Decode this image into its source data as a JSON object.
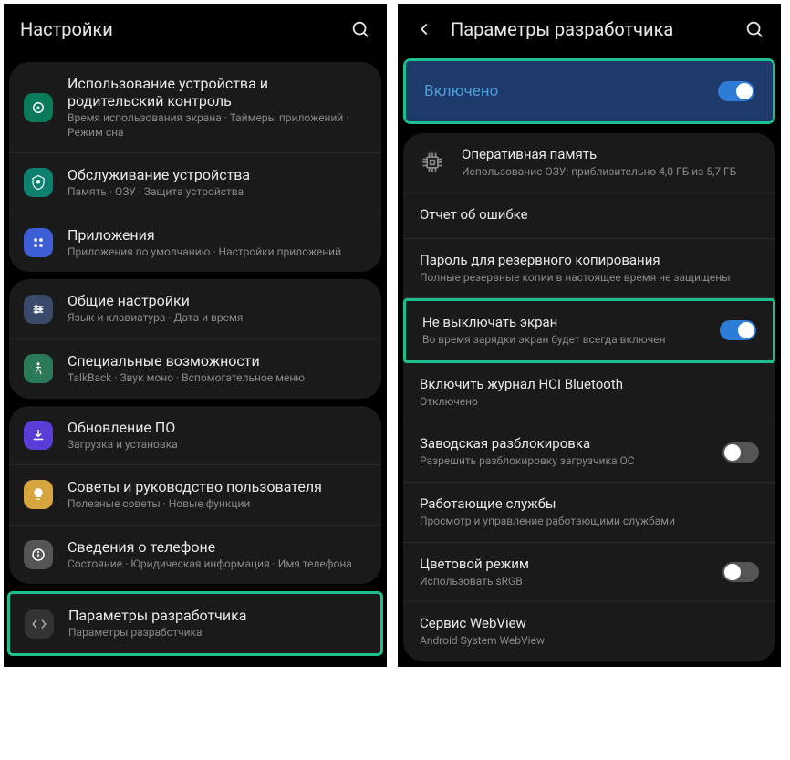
{
  "screen1": {
    "title": "Настройки",
    "groups": [
      {
        "items": [
          {
            "title": "Использование устройства и родительский контроль",
            "sub": "Время использования экрана · Таймеры приложений · Режим сна",
            "icon": "wellbeing-icon",
            "color": "ic-green"
          },
          {
            "title": "Обслуживание устройства",
            "sub": "Память · ОЗУ · Защита устройства",
            "icon": "care-icon",
            "color": "ic-teal"
          },
          {
            "title": "Приложения",
            "sub": "Приложения по умолчанию · Настройки приложений",
            "icon": "apps-icon",
            "color": "ic-blue"
          }
        ]
      },
      {
        "items": [
          {
            "title": "Общие настройки",
            "sub": "Язык и клавиатура · Дата и время",
            "icon": "settings-icon",
            "color": "ic-bluegray"
          },
          {
            "title": "Специальные возможности",
            "sub": "TalkBack · Звук моно · Вспомогательное меню",
            "icon": "accessibility-icon",
            "color": "ic-g2"
          }
        ]
      },
      {
        "items": [
          {
            "title": "Обновление ПО",
            "sub": "Загрузка и установка",
            "icon": "update-icon",
            "color": "ic-purple"
          },
          {
            "title": "Советы и руководство пользователя",
            "sub": "Полезные советы · Новые функции",
            "icon": "tips-icon",
            "color": "ic-yellow"
          },
          {
            "title": "Сведения о телефоне",
            "sub": "Состояние · Юридическая информация · Имя телефона",
            "icon": "about-icon",
            "color": "ic-gray"
          }
        ]
      }
    ],
    "developer": {
      "title": "Параметры разработчика",
      "sub": "Параметры разработчика",
      "icon": "dev-icon",
      "color": "ic-dark"
    }
  },
  "screen2": {
    "title": "Параметры разработчика",
    "enabled": "Включено",
    "items": [
      {
        "title": "Оперативная память",
        "sub": "Использование ОЗУ: приблизительно 4,0 ГБ из 5,7 ГБ",
        "hasIcon": true
      },
      {
        "title": "Отчет об ошибке",
        "sub": ""
      },
      {
        "title": "Пароль для резервного копирования",
        "sub": "Полные резервные копии в настоящее время не защищены"
      },
      {
        "title": "Не выключать экран",
        "sub": "Во время зарядки экран будет всегда включен",
        "toggle": "on",
        "highlight": true
      },
      {
        "title": "Включить журнал HCI Bluetooth",
        "sub": "Отключено"
      },
      {
        "title": "Заводская разблокировка",
        "sub": "Разрешить разблокировку загрузчика ОС",
        "toggle": "off"
      },
      {
        "title": "Работающие службы",
        "sub": "Просмотр и управление работающими службами"
      },
      {
        "title": "Цветовой режим",
        "sub": "Использовать sRGB",
        "toggle": "off"
      },
      {
        "title": "Сервис WebView",
        "sub": "Android System WebView"
      }
    ]
  }
}
